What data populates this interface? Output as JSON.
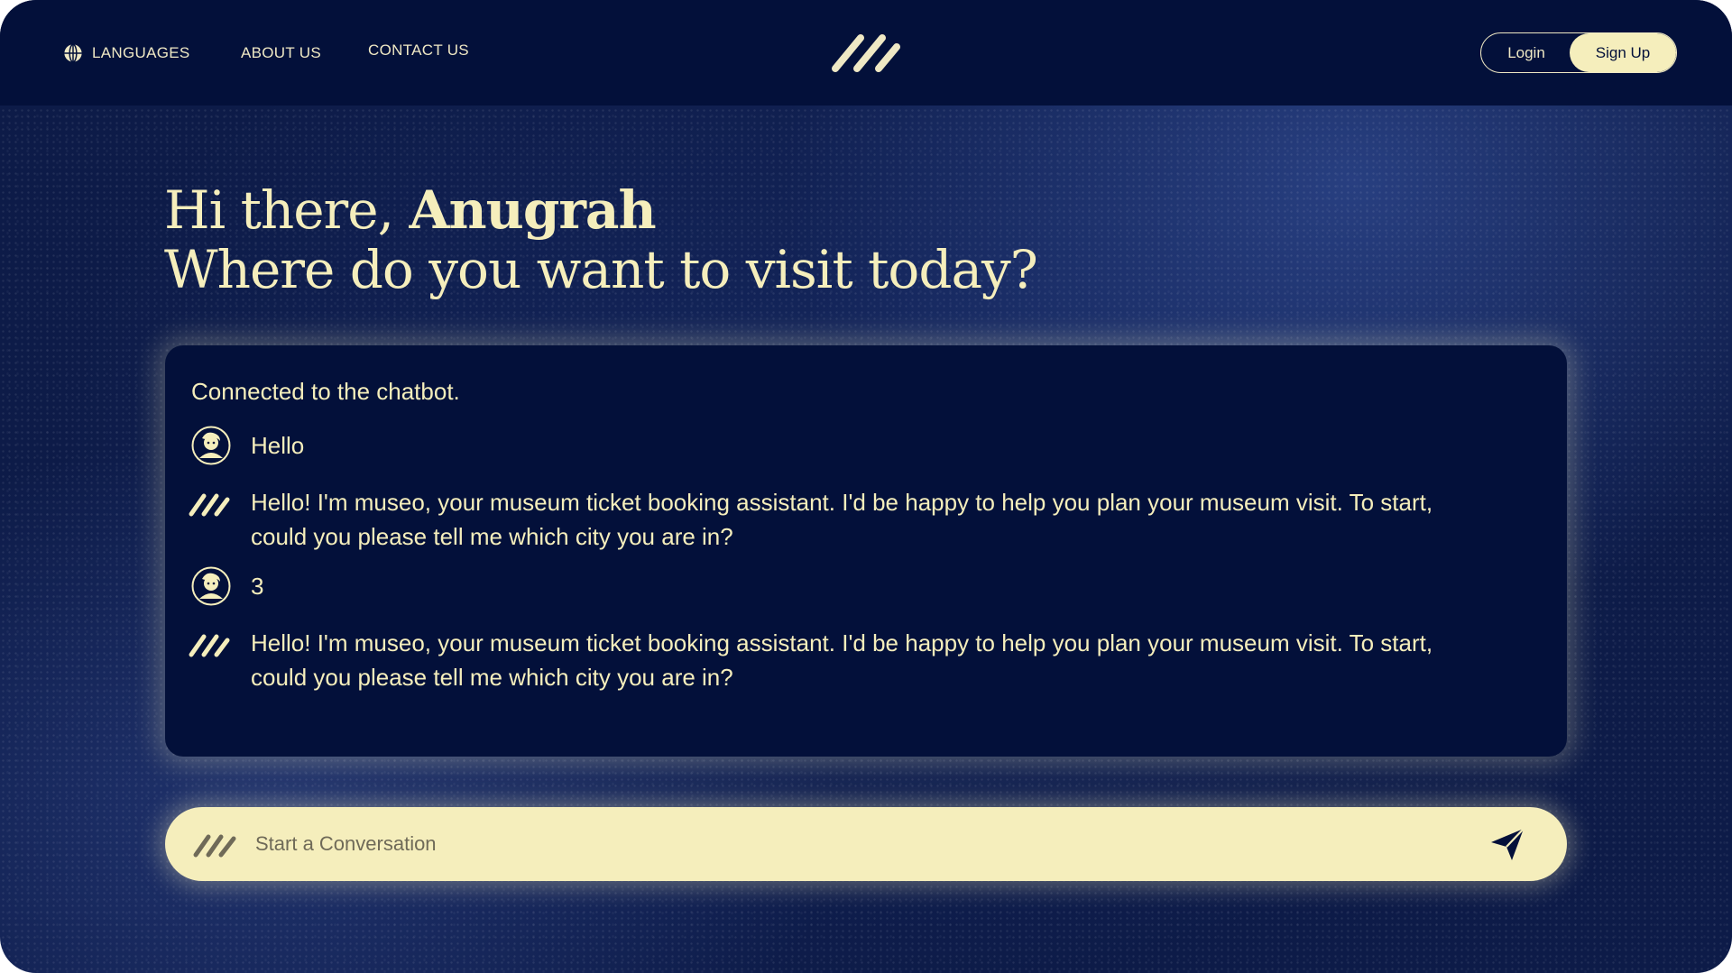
{
  "nav": {
    "languages_label": "LANGUAGES",
    "about_label": "ABOUT US",
    "contact_label": "CONTACT US",
    "login_label": "Login",
    "signup_label": "Sign Up"
  },
  "hero": {
    "greeting_prefix": "Hi there, ",
    "user_name": "Anugrah",
    "question": "Where do you want to visit today?"
  },
  "chat": {
    "status": "Connected to the chatbot.",
    "messages": [
      {
        "sender": "user",
        "text": "Hello"
      },
      {
        "sender": "bot",
        "text": "Hello! I'm museo, your museum ticket booking assistant. I'd be happy to help you plan your museum visit. To start, could you please tell me which city you are in?"
      },
      {
        "sender": "user",
        "text": "3"
      },
      {
        "sender": "bot",
        "text": "Hello! I'm museo, your museum ticket booking assistant. I'd be happy to help you plan your museum visit. To start, could you please tell me which city you are in?"
      }
    ]
  },
  "input": {
    "placeholder": "Start a Conversation"
  },
  "colors": {
    "navy": "#03103a",
    "cream": "#f5eebc",
    "background": "#15275e"
  },
  "icons": {
    "languages": "globe-icon",
    "logo": "slashes-logo",
    "user_avatar": "user-avatar-icon",
    "bot": "slashes-bot-icon",
    "send": "send-icon"
  }
}
